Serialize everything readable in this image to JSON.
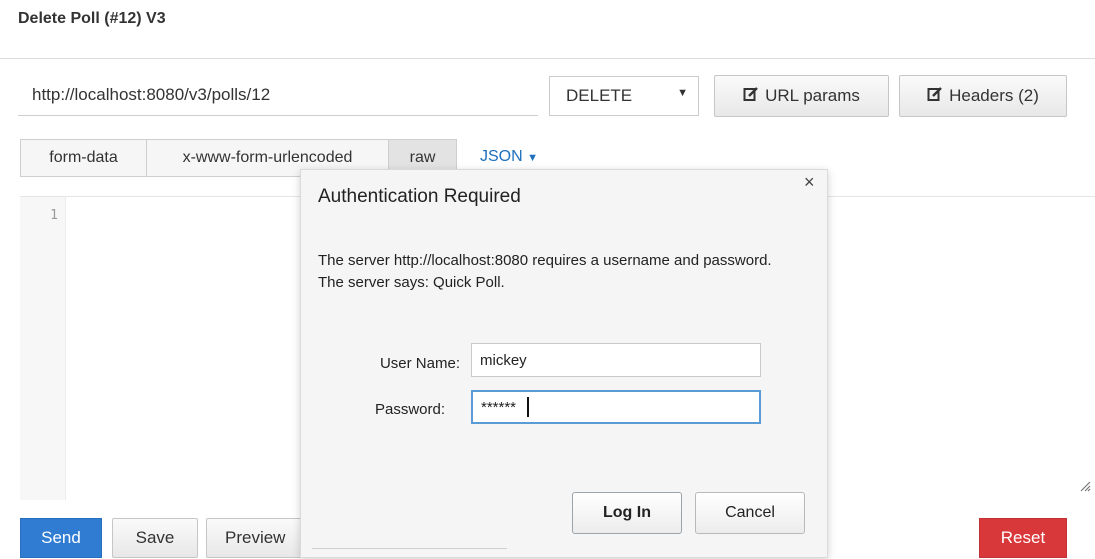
{
  "request": {
    "title": "Delete Poll (#12) V3",
    "url": "http://localhost:8080/v3/polls/12",
    "method": "DELETE",
    "url_params_label": "URL params",
    "headers_label": "Headers (2)"
  },
  "body_tabs": [
    {
      "label": "form-data"
    },
    {
      "label": "x-www-form-urlencoded"
    },
    {
      "label": "raw"
    }
  ],
  "format_dropdown": "JSON",
  "editor": {
    "line_number": "1"
  },
  "actions": {
    "send": "Send",
    "save": "Save",
    "preview": "Preview",
    "reset": "Reset"
  },
  "auth_dialog": {
    "title": "Authentication Required",
    "close": "×",
    "message": "The server http://localhost:8080 requires a username and password. The server says: Quick Poll.",
    "username_label": "User Name:",
    "username_value": "mickey",
    "password_label": "Password:",
    "password_value": "******",
    "login_label": "Log In",
    "cancel_label": "Cancel"
  },
  "colors": {
    "send": "#2f7cd2",
    "reset": "#d9383a",
    "json_link": "#1e6fbd",
    "focus_border": "#5b9bd5"
  }
}
